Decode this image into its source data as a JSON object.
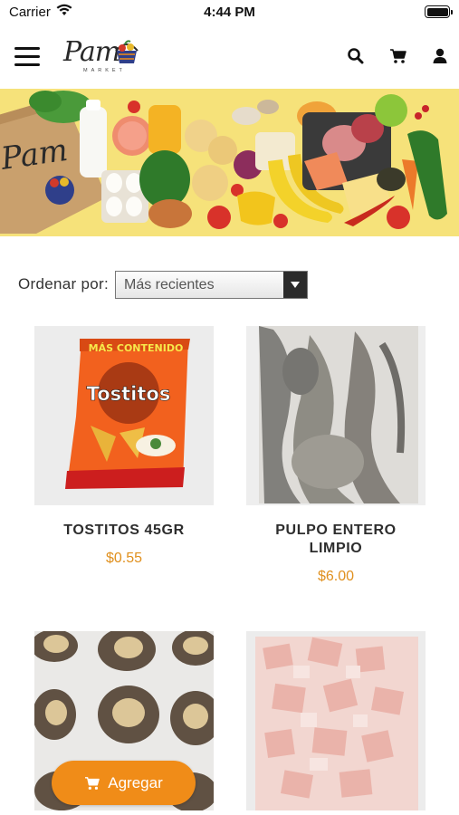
{
  "status_bar": {
    "carrier": "Carrier",
    "time": "4:44 PM",
    "battery_level": 1.0
  },
  "header": {
    "logo_text": "Pam",
    "logo_subtext": "MARKET",
    "icons": [
      "menu-icon",
      "search-icon",
      "cart-icon",
      "user-icon"
    ]
  },
  "sort": {
    "label": "Ordenar por:",
    "value": "Más recientes"
  },
  "products": [
    {
      "name": "TOSTITOS 45GR",
      "price": "$0.55"
    },
    {
      "name": "PULPO ENTERO LIMPIO",
      "price": "$6.00"
    },
    {
      "name": "",
      "price": ""
    },
    {
      "name": "",
      "price": ""
    }
  ],
  "add_button": {
    "label": "Agregar"
  },
  "colors": {
    "accent": "#f08c18",
    "price": "#e0901e",
    "banner_bg": "#f6e27a"
  }
}
